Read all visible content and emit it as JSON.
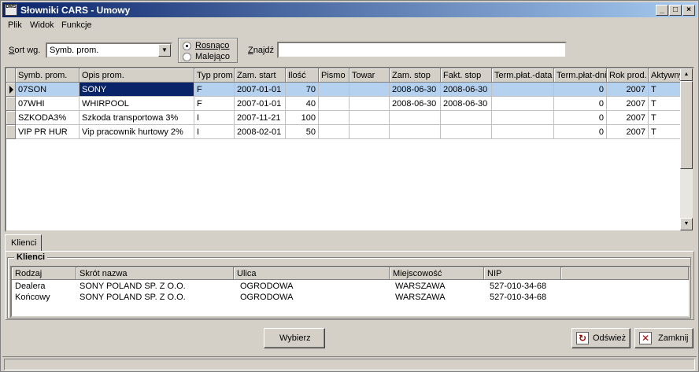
{
  "window": {
    "title": "Słowniki CARS - Umowy",
    "icon_text": "DMS",
    "min": "_",
    "max": "□",
    "close": "×"
  },
  "menu": [
    "Plik",
    "Widok",
    "Funkcje"
  ],
  "filters": {
    "sort_label_u": "S",
    "sort_label_rest": "ort wg.",
    "sort_value": "Symb. prom.",
    "radio_asc": "Rosnąco",
    "radio_desc": "Malejąco",
    "find_label_u": "Z",
    "find_label_rest": "najdź",
    "find_value": ""
  },
  "grid": {
    "columns": [
      "Symb. prom.",
      "Opis prom.",
      "Typ prom.",
      "Zam. start",
      "Ilość",
      "Pismo",
      "Towar",
      "Zam. stop",
      "Fakt. stop",
      "Term.płat.-data",
      "Term.płat-dni",
      "Rok prod.",
      "Aktywny"
    ],
    "rows": [
      [
        "07SON",
        "SONY",
        "F",
        "2007-01-01",
        "70",
        "",
        "",
        "2008-06-30",
        "2008-06-30",
        "",
        "0",
        "2007",
        "T"
      ],
      [
        "07WHI",
        "WHIRPOOL",
        "F",
        "2007-01-01",
        "40",
        "",
        "",
        "2008-06-30",
        "2008-06-30",
        "",
        "0",
        "2007",
        "T"
      ],
      [
        "SZKODA3%",
        "Szkoda transportowa 3%",
        "I",
        "2007-11-21",
        "100",
        "",
        "",
        "",
        "",
        "",
        "0",
        "2007",
        "T"
      ],
      [
        "VIP PR HUR",
        "Vip pracownik hurtowy 2%",
        "I",
        "2008-02-01",
        "50",
        "",
        "",
        "",
        "",
        "",
        "0",
        "2007",
        "T"
      ]
    ]
  },
  "tab": "Klienci",
  "clients": {
    "title": "Klienci",
    "columns": [
      "Rodzaj",
      "Skrót nazwa",
      "Ulica",
      "Miejscowość",
      "NIP"
    ],
    "rows": [
      [
        "Dealera",
        "SONY POLAND SP. Z O.O.",
        "OGRODOWA",
        "WARSZAWA",
        "527-010-34-68"
      ],
      [
        "Końcowy",
        "SONY POLAND SP. Z O.O.",
        "OGRODOWA",
        "WARSZAWA",
        "527-010-34-68"
      ]
    ]
  },
  "buttons": {
    "select": "Wybierz",
    "refresh": "Odśwież",
    "close": "Zamknij"
  }
}
